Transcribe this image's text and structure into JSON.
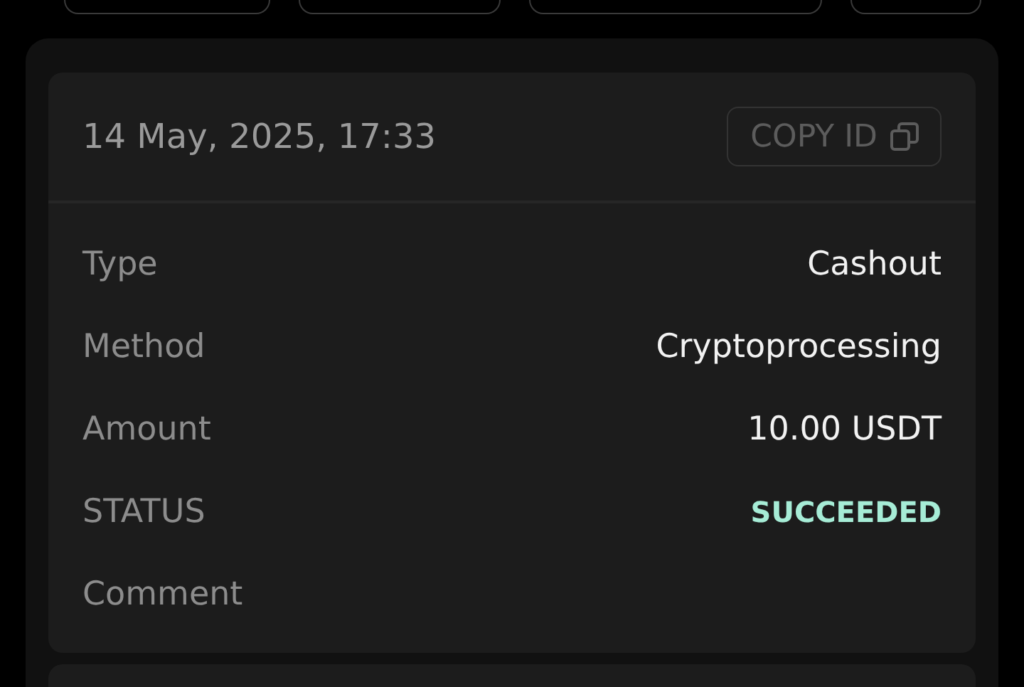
{
  "transaction": {
    "date": "14 May, 2025, 17:33",
    "copy_button": "COPY ID",
    "rows": [
      {
        "kind": "text",
        "label": "Type",
        "value": "Cashout"
      },
      {
        "kind": "text",
        "label": "Method",
        "value": "Cryptoprocessing"
      },
      {
        "kind": "text",
        "label": "Amount",
        "value": "10.00 USDT"
      },
      {
        "kind": "status",
        "label": "STATUS",
        "value": "SUCCEEDED"
      },
      {
        "kind": "empty",
        "label": "Comment"
      }
    ]
  }
}
